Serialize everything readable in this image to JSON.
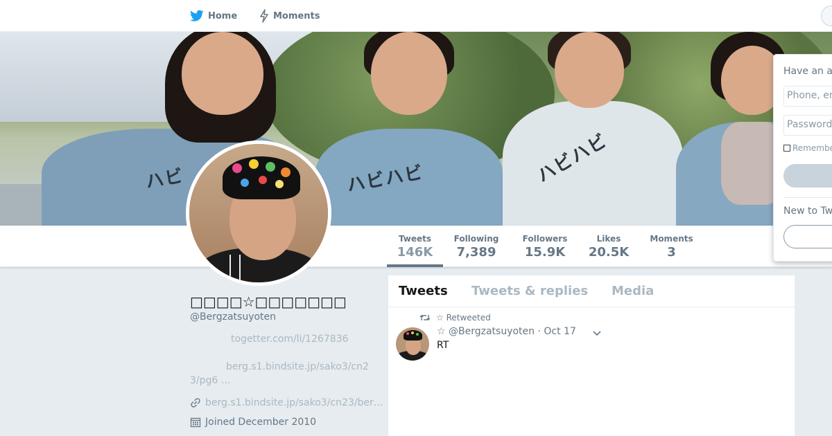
{
  "nav": {
    "home_label": "Home",
    "moments_label": "Moments"
  },
  "profile": {
    "name": "□□□□☆□□□□□□□",
    "handle": "@Bergzatsuyoten",
    "bio_lines": [
      "togetter.com/li/1267836",
      "berg.s1.bindsite.jp/sako3/cn2",
      "3/pg6 …"
    ],
    "url": "berg.s1.bindsite.jp/sako3/cn23/ber…",
    "joined": "Joined December 2010"
  },
  "stats": [
    {
      "label": "Tweets",
      "value": "146K"
    },
    {
      "label": "Following",
      "value": "7,389"
    },
    {
      "label": "Followers",
      "value": "15.9K"
    },
    {
      "label": "Likes",
      "value": "20.5K"
    },
    {
      "label": "Moments",
      "value": "3"
    }
  ],
  "timeline": {
    "tabs": [
      "Tweets",
      "Tweets & replies",
      "Media"
    ],
    "retweeted_label": "☆ Retweeted",
    "tweet": {
      "author": "☆ @Bergzatsuyoten",
      "date": "· Oct 17",
      "text": "RT"
    }
  },
  "login": {
    "title": "Have an a",
    "phone_placeholder": "Phone, em",
    "password_placeholder": "Password",
    "remember_label": "Remembe",
    "signup_title": "New to Tw"
  },
  "colors": {
    "brand": "#1da1f2",
    "text_muted": "#657786",
    "background": "#e6ecf0"
  },
  "icons": [
    "twitter-bird-icon",
    "lightning-icon",
    "link-icon",
    "calendar-icon",
    "retweet-icon",
    "chevron-down-icon"
  ]
}
